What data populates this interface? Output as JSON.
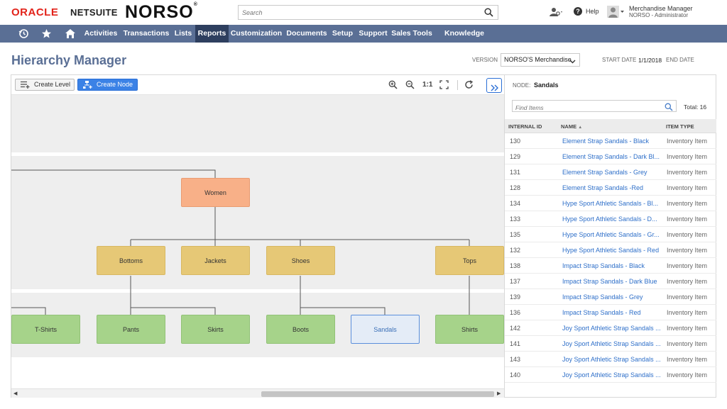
{
  "brand": {
    "oracle": "ORACLE",
    "netsuite": "NETSUITE",
    "company": "NORSO",
    "registered": "®"
  },
  "search": {
    "placeholder": "Search"
  },
  "top": {
    "help": "Help",
    "user_name": "Merchandise Manager",
    "user_role": "NORSO - Administrator"
  },
  "nav": {
    "items": [
      "Activities",
      "Transactions",
      "Lists",
      "Reports",
      "Customization",
      "Documents",
      "Setup",
      "Support",
      "Sales Tools",
      "Knowledge Base"
    ],
    "active": "Reports"
  },
  "page": {
    "title": "Hierarchy Manager"
  },
  "version": {
    "label": "VERSION",
    "value": "NORSO'S Merchandise"
  },
  "dates": {
    "start_label": "START DATE",
    "start_value": "1/1/2018",
    "end_label": "END DATE"
  },
  "toolbar": {
    "create_level": "Create Level",
    "create_node": "Create Node",
    "one_to_one": "1:1"
  },
  "tree": {
    "root": "Women",
    "level2": [
      "Bottoms",
      "Jackets",
      "Shoes",
      "Tops"
    ],
    "level3": [
      "T-Shirts",
      "Pants",
      "Skirts",
      "Boots",
      "Sandals",
      "Shirts"
    ],
    "selected": "Sandals"
  },
  "panel": {
    "node_label": "NODE:",
    "node_value": "Sandals",
    "find_placeholder": "Find Items",
    "total": "Total: 16",
    "columns": {
      "id": "INTERNAL ID",
      "name": "NAME",
      "type": "ITEM TYPE"
    },
    "rows": [
      {
        "id": "130",
        "name": "Element Strap Sandals - Black",
        "type": "Inventory Item"
      },
      {
        "id": "129",
        "name": "Element Strap Sandals - Dark Bl...",
        "type": "Inventory Item"
      },
      {
        "id": "131",
        "name": "Element Strap Sandals - Grey",
        "type": "Inventory Item"
      },
      {
        "id": "128",
        "name": "Element Strap Sandals -Red",
        "type": "Inventory Item"
      },
      {
        "id": "134",
        "name": "Hype Sport Athletic Sandals - Bl...",
        "type": "Inventory Item"
      },
      {
        "id": "133",
        "name": "Hype Sport Athletic Sandals - D...",
        "type": "Inventory Item"
      },
      {
        "id": "135",
        "name": "Hype Sport Athletic Sandals - Gr...",
        "type": "Inventory Item"
      },
      {
        "id": "132",
        "name": "Hype Sport Athletic Sandals - Red",
        "type": "Inventory Item"
      },
      {
        "id": "138",
        "name": "Impact Strap Sandals - Black",
        "type": "Inventory Item"
      },
      {
        "id": "137",
        "name": "Impact Strap Sandals - Dark Blue",
        "type": "Inventory Item"
      },
      {
        "id": "139",
        "name": "Impact Strap Sandals - Grey",
        "type": "Inventory Item"
      },
      {
        "id": "136",
        "name": "Impact Strap Sandals - Red",
        "type": "Inventory Item"
      },
      {
        "id": "142",
        "name": "Joy Sport Athletic Strap Sandals ...",
        "type": "Inventory Item"
      },
      {
        "id": "141",
        "name": "Joy Sport Athletic Strap Sandals ...",
        "type": "Inventory Item"
      },
      {
        "id": "143",
        "name": "Joy Sport Athletic Strap Sandals ...",
        "type": "Inventory Item"
      },
      {
        "id": "140",
        "name": "Joy Sport Athletic Strap Sandals ...",
        "type": "Inventory Item"
      }
    ]
  },
  "colors": {
    "nav_bg": "#5a6f95",
    "nav_active": "#2e3f5f",
    "link": "#2e6fc9",
    "accent_button": "#3b82e6"
  }
}
